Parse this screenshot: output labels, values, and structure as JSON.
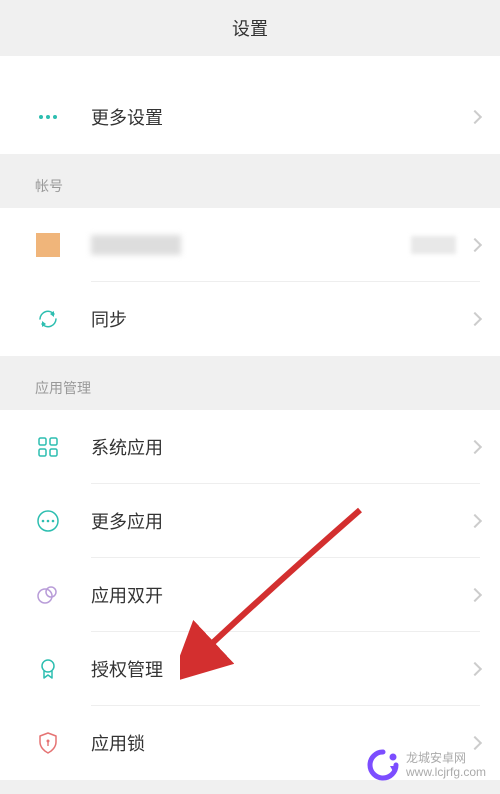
{
  "header": {
    "title": "设置"
  },
  "sections": {
    "top": {
      "more_settings": "更多设置"
    },
    "account": {
      "header": "帐号",
      "sync": "同步"
    },
    "app_management": {
      "header": "应用管理",
      "system_apps": "系统应用",
      "more_apps": "更多应用",
      "dual_apps": "应用双开",
      "permissions": "授权管理",
      "app_lock": "应用锁"
    }
  },
  "watermark": {
    "brand": "龙城安卓网",
    "url": "www.lcjrfg.com"
  },
  "icons": {
    "more": "more-horizontal-icon",
    "avatar": "avatar-placeholder",
    "sync": "sync-icon",
    "apps": "apps-grid-icon",
    "more_apps": "more-circle-icon",
    "dual": "dual-circle-icon",
    "permission": "badge-icon",
    "lock": "shield-lock-icon"
  },
  "colors": {
    "accent_teal": "#2dbeb0",
    "accent_orange": "#f0b57a",
    "accent_purple": "#b89cd8",
    "accent_red": "#e57373",
    "arrow_red": "#d32f2f"
  }
}
